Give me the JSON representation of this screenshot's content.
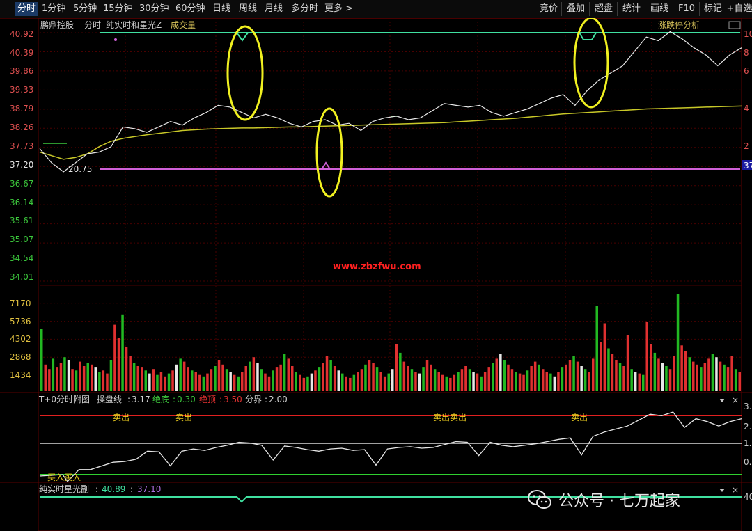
{
  "toolbar": {
    "tabs": [
      "分时",
      "1分钟",
      "5分钟",
      "15分钟",
      "30分钟",
      "60分钟",
      "日线",
      "周线",
      "月线",
      "多分时",
      "更多 >"
    ],
    "right_buttons": [
      "竞价",
      "叠加",
      "超盘",
      "统计",
      "画线",
      "F10",
      "标记",
      "+自选"
    ]
  },
  "main": {
    "stock_name": "鹏鼎控股",
    "mode_label": "分时",
    "indicator_label": "纯实时和星光Z",
    "volume_label": "成交量",
    "limit_label": "涨跌停分析",
    "min_label": "20.75",
    "right_edge_price": "37",
    "price_ticks": [
      "40.92",
      "40.39",
      "39.86",
      "39.33",
      "38.79",
      "38.26",
      "37.73",
      "37.20",
      "36.67",
      "36.14",
      "35.61",
      "35.07",
      "34.54",
      "34.01"
    ],
    "right_pct_ticks": [
      "10",
      "8",
      "6",
      "4",
      "2",
      "0"
    ],
    "watermark_url": "www.zbzfwu.com",
    "volume_ticks": [
      "7170",
      "5736",
      "4302",
      "2868",
      "1434"
    ]
  },
  "panel1": {
    "title": "T+0分时附图",
    "items": [
      {
        "name": "操盘线",
        "value": "3.17"
      },
      {
        "name": "绝底",
        "value": "0.30"
      },
      {
        "name": "绝顶",
        "value": "3.50"
      },
      {
        "name": "分界",
        "value": "2.00"
      }
    ],
    "sell_labels": [
      "卖出",
      "卖出",
      "卖出卖出",
      "卖出"
    ],
    "buy_label": "买入买入",
    "right_ticks": [
      "3.",
      "2.",
      "1.",
      "0."
    ]
  },
  "panel2": {
    "title": "纯实时星光副",
    "value1": "40.89",
    "value2": "37.10",
    "right_tick": "40"
  },
  "chart_data": {
    "type": "line",
    "title": "",
    "xlabel": "",
    "ylabel": "",
    "ylim": [
      33.75,
      41.2
    ],
    "series": [
      {
        "name": "",
        "values": [
          37.7,
          37.3,
          37.05,
          37.3,
          37.55,
          37.6,
          37.75,
          38.3,
          38.25,
          38.15,
          38.3,
          38.45,
          38.35,
          38.55,
          38.7,
          38.9,
          38.85,
          38.7,
          38.55,
          38.65,
          38.55,
          38.4,
          38.3,
          38.45,
          38.5,
          38.35,
          38.4,
          38.2,
          38.45,
          38.55,
          38.6,
          38.5,
          38.55,
          38.75,
          38.95,
          38.9,
          38.85,
          38.9,
          38.7,
          38.6,
          38.7,
          38.8,
          38.95,
          39.1,
          39.2,
          38.9,
          39.3,
          39.6,
          39.8,
          40.0,
          40.4,
          40.8,
          40.7,
          40.95,
          40.75,
          40.5,
          40.3,
          40.0,
          40.3,
          40.5
        ]
      },
      {
        "name": "",
        "values": [
          37.6,
          37.5,
          37.4,
          37.45,
          37.55,
          37.75,
          37.9,
          37.98,
          38.03,
          38.08,
          38.12,
          38.16,
          38.2,
          38.22,
          38.24,
          38.25,
          38.26,
          38.27,
          38.27,
          38.28,
          38.29,
          38.3,
          38.3,
          38.31,
          38.32,
          38.33,
          38.34,
          38.35,
          38.36,
          38.37,
          38.38,
          38.39,
          38.4,
          38.41,
          38.42,
          38.44,
          38.46,
          38.48,
          38.5,
          38.52,
          38.54,
          38.57,
          38.6,
          38.63,
          38.66,
          38.68,
          38.7,
          38.72,
          38.74,
          38.76,
          38.78,
          38.8,
          38.81,
          38.82,
          38.83,
          38.84,
          38.85,
          38.86,
          38.87,
          38.88
        ]
      }
    ],
    "volume": [
      4200,
      1800,
      1500,
      2200,
      1600,
      1900,
      2300,
      2100,
      1500,
      1400,
      2000,
      1700,
      1900,
      1800,
      1600,
      1300,
      1400,
      1200,
      2100,
      4500,
      3600,
      5200,
      3000,
      2400,
      1900,
      1700,
      1600,
      1400,
      1200,
      1500,
      1100,
      1300,
      1000,
      1200,
      1400,
      1800,
      2200,
      2000,
      1600,
      1400,
      1300,
      1100,
      1000,
      1200,
      1500,
      1700,
      2100,
      1800,
      1500,
      1300,
      1100,
      1000,
      1300,
      1700,
      2000,
      2300,
      1900,
      1500,
      1200,
      1000,
      1400,
      1600,
      1800,
      2500,
      2200,
      1700,
      1300,
      1100,
      900,
      1000,
      1200,
      1400,
      1600,
      1900,
      2400,
      2100,
      1700,
      1400,
      1200,
      1000,
      900,
      1100,
      1300,
      1500,
      1800,
      2100,
      1900,
      1600,
      1300,
      1000,
      1200,
      1500,
      3200,
      2600,
      2000,
      1700,
      1500,
      1300,
      1200,
      1600,
      2100,
      1800,
      1500,
      1300,
      1100,
      1000,
      900,
      1100,
      1300,
      1500,
      1700,
      1500,
      1300,
      1200,
      1000,
      1300,
      1600,
      1900,
      2200,
      2500,
      2100,
      1800,
      1500,
      1300,
      1200,
      1100,
      1400,
      1700,
      2000,
      1800,
      1500,
      1300,
      1200,
      1000,
      1300,
      1600,
      1800,
      2100,
      2400,
      2000,
      1700,
      1500,
      1300,
      2200,
      5800,
      3300,
      4600,
      2900,
      2500,
      2100,
      1900,
      1700,
      3800,
      1500,
      1300,
      1200,
      1100,
      4700,
      3200,
      2600,
      2200,
      1900,
      1700,
      1500,
      2400,
      6600,
      3100,
      2700,
      2300,
      2000,
      1800,
      1600,
      1900,
      2200,
      2500,
      2300,
      2000,
      1800,
      1600,
      2400,
      1500,
      1300
    ]
  }
}
